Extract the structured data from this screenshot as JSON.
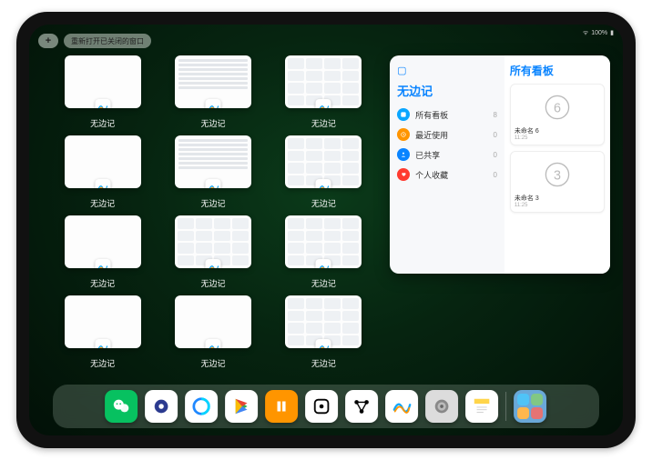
{
  "status": {
    "time": "",
    "battery": "100%",
    "wifi": "●"
  },
  "header": {
    "plus": "+",
    "reopen_label": "重新打开已关闭的窗口"
  },
  "app_name": "无边记",
  "windows": [
    {
      "variant": "blank",
      "label": "无边记"
    },
    {
      "variant": "list",
      "label": "无边记"
    },
    {
      "variant": "grid",
      "label": "无边记"
    },
    {
      "variant": "blank",
      "label": "无边记"
    },
    {
      "variant": "list",
      "label": "无边记"
    },
    {
      "variant": "grid",
      "label": "无边记"
    },
    {
      "variant": "blank",
      "label": "无边记"
    },
    {
      "variant": "grid",
      "label": "无边记"
    },
    {
      "variant": "grid",
      "label": "无边记"
    },
    {
      "variant": "blank",
      "label": "无边记"
    },
    {
      "variant": "blank",
      "label": "无边记"
    },
    {
      "variant": "grid",
      "label": "无边记"
    }
  ],
  "side_panel": {
    "left_title": "无边记",
    "items": [
      {
        "label": "所有看板",
        "count": 8,
        "color": "#0aa6ff"
      },
      {
        "label": "最近使用",
        "count": 0,
        "color": "#ff9500"
      },
      {
        "label": "已共享",
        "count": 0,
        "color": "#0a84ff"
      },
      {
        "label": "个人收藏",
        "count": 0,
        "color": "#ff3b30"
      }
    ],
    "right_title": "所有看板",
    "boards": [
      {
        "name": "未命名 6",
        "time": "11:25",
        "glyph": "6"
      },
      {
        "name": "未命名 3",
        "time": "11:25",
        "glyph": "3"
      }
    ],
    "more": "···"
  },
  "dock": {
    "apps": [
      {
        "name": "wechat",
        "bg": "#07c160"
      },
      {
        "name": "quark",
        "bg": "#ffffff"
      },
      {
        "name": "qqbrowser",
        "bg": "#ffffff"
      },
      {
        "name": "play",
        "bg": "#ffffff"
      },
      {
        "name": "books",
        "bg": "#ff9500"
      },
      {
        "name": "dice",
        "bg": "#ffffff"
      },
      {
        "name": "nodes",
        "bg": "#ffffff"
      },
      {
        "name": "freeform",
        "bg": "#ffffff"
      },
      {
        "name": "settings",
        "bg": "#dcdcdc"
      },
      {
        "name": "notes",
        "bg": "#ffffff"
      },
      {
        "name": "app-library",
        "bg": "#6aa8d8"
      }
    ]
  }
}
